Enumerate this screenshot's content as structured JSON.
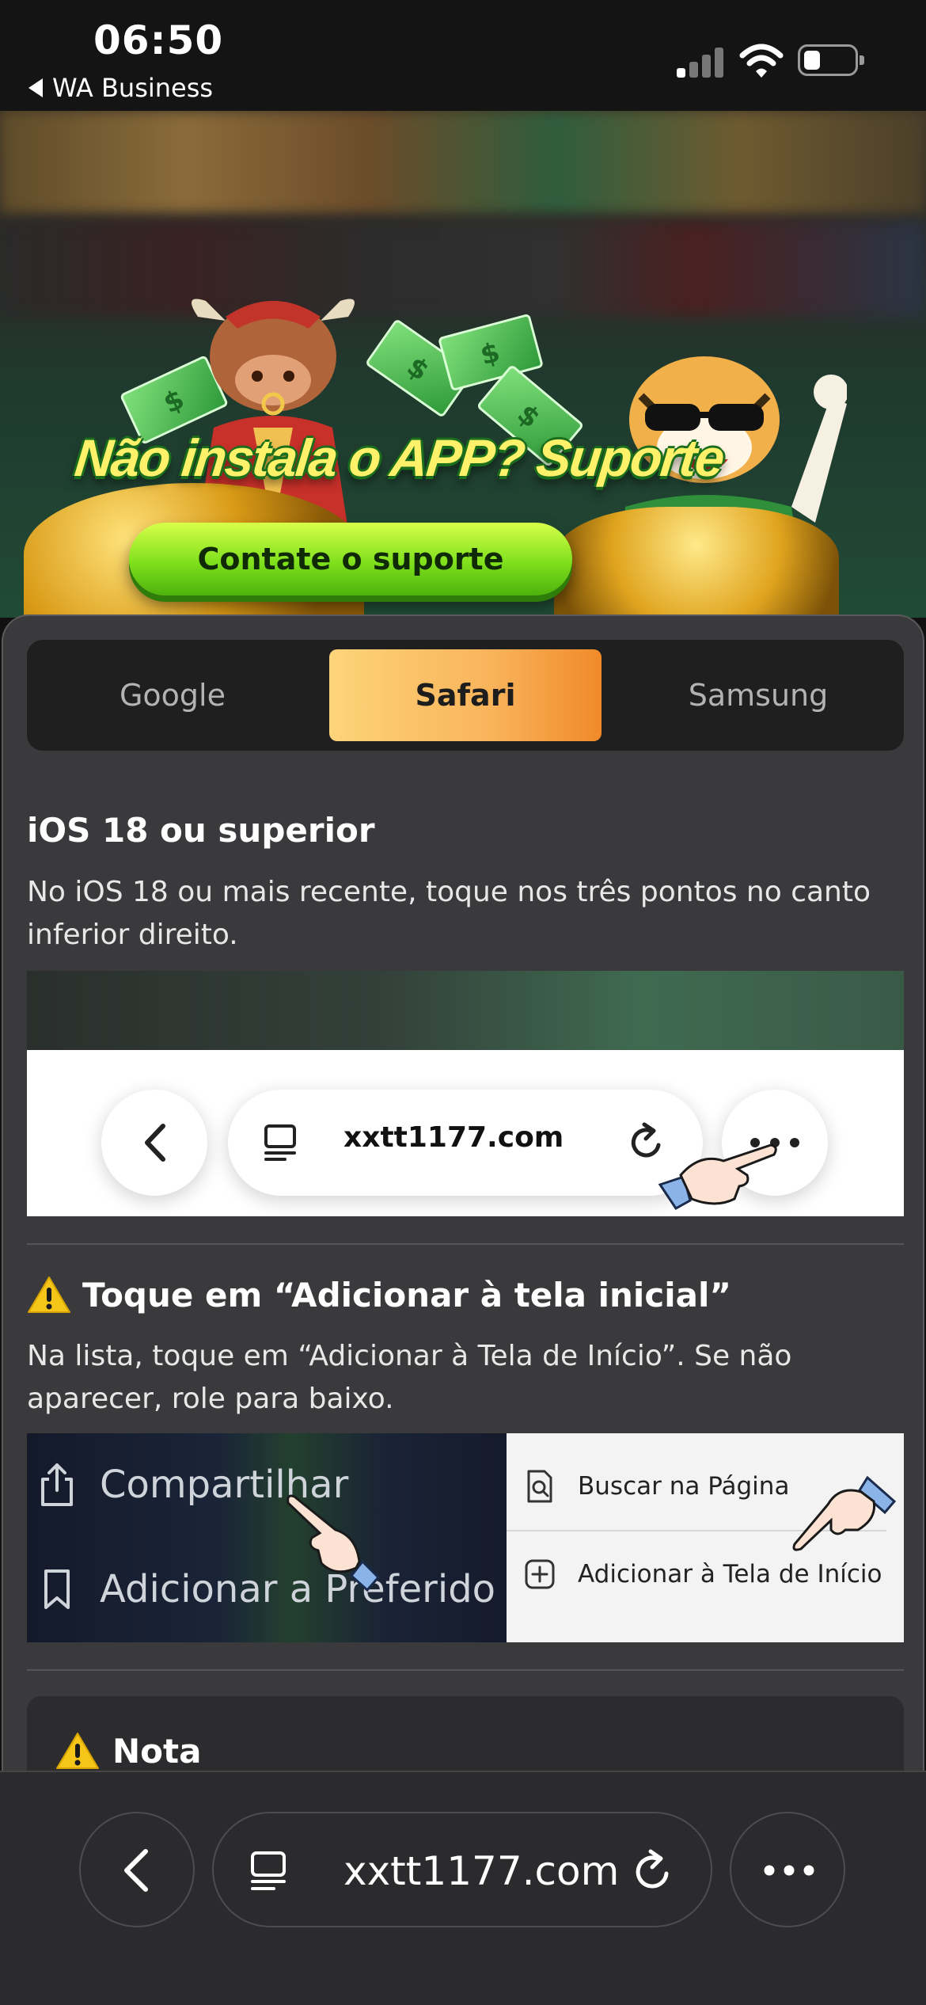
{
  "status_bar": {
    "time": "06:50",
    "back_app": "WA Business",
    "icons": [
      "signal-icon",
      "wifi-icon",
      "battery-icon"
    ]
  },
  "banner": {
    "title": "Não instala o APP? Suporte",
    "button_label": "Contate o suporte"
  },
  "tabs": [
    {
      "label": "Google",
      "active": false
    },
    {
      "label": "Safari",
      "active": true
    },
    {
      "label": "Samsung",
      "active": false
    }
  ],
  "step1": {
    "title": "iOS 18 ou superior",
    "text": "No iOS 18 ou mais recente, toque nos três pontos no canto inferior direito.",
    "illustration": {
      "url": "xxtt1177.com"
    }
  },
  "step2": {
    "title": "Toque em “Adicionar à tela inicial”",
    "text": "Na lista, toque em “Adicionar à Tela de Início”. Se não aparecer, role para baixo.",
    "illustration": {
      "left_items": [
        "Compartilhar",
        "Adicionar a Preferido"
      ],
      "right_items": [
        "Buscar na Página",
        "Adicionar à Tela de Início"
      ]
    }
  },
  "note": {
    "title": "Nota"
  },
  "browser_bar": {
    "url": "xxtt1177.com"
  },
  "colors": {
    "tab_active_start": "#fdd47a",
    "tab_active_end": "#f08a2a",
    "sheet_bg": "#3a3a3c",
    "warning": "#f5c518",
    "cta_green": "#7fe01c"
  }
}
